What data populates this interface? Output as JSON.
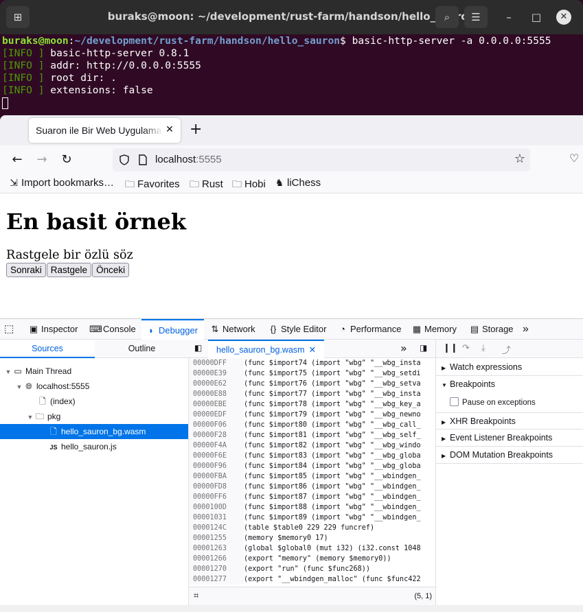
{
  "terminal": {
    "title": "buraks@moon: ~/development/rust-farm/handson/hello_sauron",
    "prompt_user": "buraks@moon",
    "prompt_path": "~/development/rust-farm/handson/hello_sauron",
    "command": "$ basic-http-server -a 0.0.0.0:5555",
    "lines": [
      {
        "tag": "[INFO ]",
        "text": " basic-http-server 0.8.1"
      },
      {
        "tag": "[INFO ]",
        "text": " addr: http://0.0.0.0:5555"
      },
      {
        "tag": "[INFO ]",
        "text": " root dir: ."
      },
      {
        "tag": "[INFO ]",
        "text": " extensions: false"
      }
    ]
  },
  "browser": {
    "tab_title": "Suaron ile Bir Web Uygulaması",
    "url_host": "localhost",
    "url_port": ":5555",
    "bookmarks": [
      {
        "label": "Import bookmarks…",
        "icon": "import-icon"
      },
      {
        "label": "Favorites",
        "icon": "folder-icon"
      },
      {
        "label": "Rust",
        "icon": "folder-icon"
      },
      {
        "label": "Hobi",
        "icon": "folder-icon"
      },
      {
        "label": "liChess",
        "icon": "lichess-icon"
      }
    ]
  },
  "page": {
    "heading": "En basit örnek",
    "quote": "Rastgele bir özlü söz",
    "buttons": [
      "Sonraki",
      "Rastgele",
      "Önceki"
    ]
  },
  "devtools": {
    "tabs": [
      "Inspector",
      "Console",
      "Debugger",
      "Network",
      "Style Editor",
      "Performance",
      "Memory",
      "Storage"
    ],
    "active_tab": "Debugger",
    "left_tabs": [
      "Sources",
      "Outline"
    ],
    "tree": [
      "Main Thread",
      "localhost:5555",
      "(index)",
      "pkg",
      "hello_sauron_bg.wasm",
      "hello_sauron.js"
    ],
    "source_tab": "hello_sauron_bg.wasm",
    "code": [
      {
        "off": "00000DFF",
        "txt": "(func $import74 (import \"wbg\" \"__wbg_insta"
      },
      {
        "off": "00000E39",
        "txt": "(func $import75 (import \"wbg\" \"__wbg_setdi"
      },
      {
        "off": "00000E62",
        "txt": "(func $import76 (import \"wbg\" \"__wbg_setva"
      },
      {
        "off": "00000E88",
        "txt": "(func $import77 (import \"wbg\" \"__wbg_insta"
      },
      {
        "off": "00000EBE",
        "txt": "(func $import78 (import \"wbg\" \"__wbg_key_a"
      },
      {
        "off": "00000EDF",
        "txt": "(func $import79 (import \"wbg\" \"__wbg_newno"
      },
      {
        "off": "00000F06",
        "txt": "(func $import80 (import \"wbg\" \"__wbg_call_"
      },
      {
        "off": "00000F28",
        "txt": "(func $import81 (import \"wbg\" \"__wbg_self_"
      },
      {
        "off": "00000F4A",
        "txt": "(func $import82 (import \"wbg\" \"__wbg_windo"
      },
      {
        "off": "00000F6E",
        "txt": "(func $import83 (import \"wbg\" \"__wbg_globa"
      },
      {
        "off": "00000F96",
        "txt": "(func $import84 (import \"wbg\" \"__wbg_globa"
      },
      {
        "off": "00000FBA",
        "txt": "(func $import85 (import \"wbg\" \"__wbindgen_"
      },
      {
        "off": "00000FD8",
        "txt": "(func $import86 (import \"wbg\" \"__wbindgen_"
      },
      {
        "off": "00000FF6",
        "txt": "(func $import87 (import \"wbg\" \"__wbindgen_"
      },
      {
        "off": "0000100D",
        "txt": "(func $import88 (import \"wbg\" \"__wbindgen_"
      },
      {
        "off": "00001031",
        "txt": "(func $import89 (import \"wbg\" \"__wbindgen_"
      },
      {
        "off": "0000124C",
        "txt": "(table $table0 229 229 funcref)"
      },
      {
        "off": "00001255",
        "txt": "(memory $memory0 17)"
      },
      {
        "off": "00001263",
        "txt": "(global $global0 (mut i32) (i32.const 1048"
      },
      {
        "off": "00001266",
        "txt": "(export \"memory\" (memory $memory0))"
      },
      {
        "off": "00001270",
        "txt": "(export \"run\" (func $func268))"
      },
      {
        "off": "00001277",
        "txt": "(export \"__wbindgen_malloc\" (func $func422"
      }
    ],
    "cursor_pos": "(5, 1)",
    "right_panels": [
      "Watch expressions",
      "Breakpoints",
      "XHR Breakpoints",
      "Event Listener Breakpoints",
      "DOM Mutation Breakpoints"
    ],
    "pause_on_exceptions": "Pause on exceptions"
  }
}
